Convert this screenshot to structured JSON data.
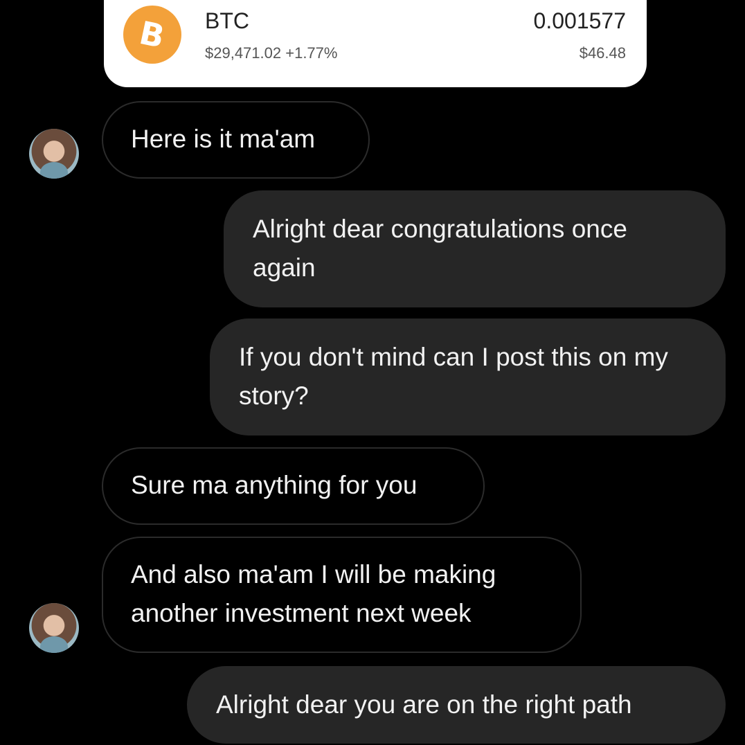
{
  "crypto_card": {
    "symbol": "BTC",
    "price": "$29,471.02",
    "change": "+1.77%",
    "amount": "0.001577",
    "fiat_value": "$46.48",
    "icon": "bitcoin-icon",
    "accent": "#f3a13a"
  },
  "messages": [
    {
      "direction": "incoming",
      "text": "Here is it ma'am"
    },
    {
      "direction": "outgoing",
      "text": "Alright dear congratulations once again"
    },
    {
      "direction": "outgoing",
      "text": "If you don't mind can I post this on my story?"
    },
    {
      "direction": "incoming",
      "text": "Sure ma anything for you"
    },
    {
      "direction": "incoming",
      "text": "And also ma'am I will be making another investment next week"
    },
    {
      "direction": "outgoing",
      "text": "Alright dear you are on the right path"
    }
  ],
  "colors": {
    "background": "#000000",
    "outgoing_bubble": "#262626",
    "incoming_border": "#2b2b2b",
    "text": "#f2f2f2"
  }
}
